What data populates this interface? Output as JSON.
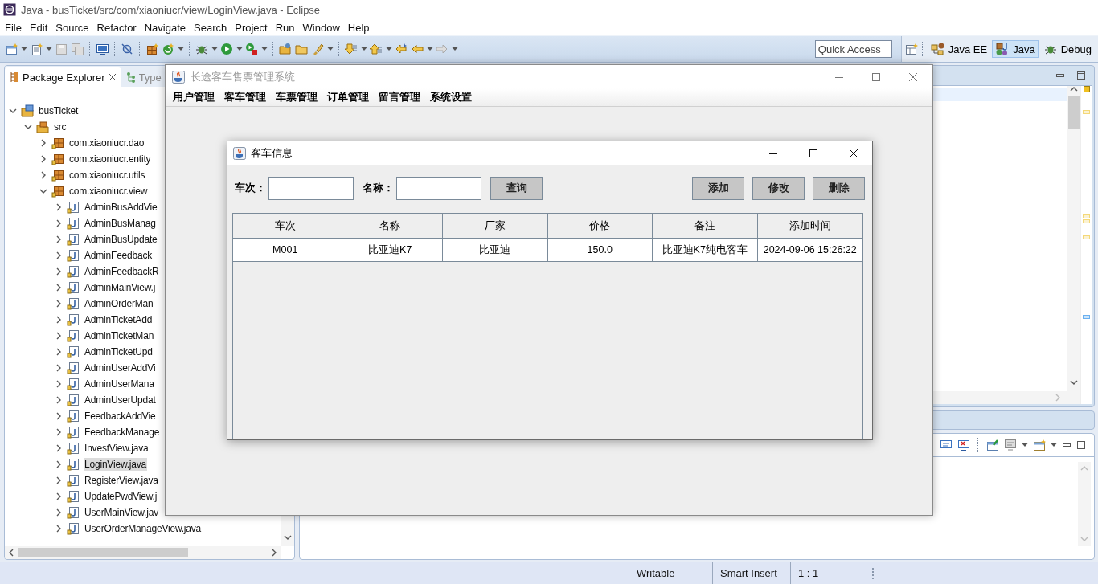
{
  "ide": {
    "title": "Java - busTicket/src/com/xiaoniucr/view/LoginView.java - Eclipse",
    "menu": [
      "File",
      "Edit",
      "Source",
      "Refactor",
      "Navigate",
      "Search",
      "Project",
      "Run",
      "Window",
      "Help"
    ],
    "quick_access": {
      "placeholder": "Quick Access"
    },
    "perspectives": [
      {
        "label": "Java EE",
        "selected": false
      },
      {
        "label": "Java",
        "selected": true
      },
      {
        "label": "Debug",
        "selected": false
      }
    ],
    "view_tabs": [
      {
        "label": "Package Explorer",
        "selected": true
      },
      {
        "label": "Type",
        "selected": false
      }
    ],
    "tree": [
      {
        "label": "busTicket",
        "kind": "project",
        "expanded": true,
        "selected": false,
        "children": [
          {
            "label": "src",
            "kind": "source",
            "expanded": true,
            "selected": false,
            "children": [
              {
                "label": "com.xiaoniucr.dao",
                "kind": "package",
                "expanded": false,
                "selected": false
              },
              {
                "label": "com.xiaoniucr.entity",
                "kind": "package",
                "expanded": false,
                "selected": false
              },
              {
                "label": "com.xiaoniucr.utils",
                "kind": "package",
                "expanded": false,
                "selected": false
              },
              {
                "label": "com.xiaoniucr.view",
                "kind": "package",
                "expanded": true,
                "selected": false,
                "children": [
                  {
                    "label": "AdminBusAddVie",
                    "kind": "file",
                    "expanded": false,
                    "selected": false
                  },
                  {
                    "label": "AdminBusManag",
                    "kind": "file",
                    "expanded": false,
                    "selected": false
                  },
                  {
                    "label": "AdminBusUpdate",
                    "kind": "file",
                    "expanded": false,
                    "selected": false
                  },
                  {
                    "label": "AdminFeedback",
                    "kind": "file",
                    "expanded": false,
                    "selected": false
                  },
                  {
                    "label": "AdminFeedbackR",
                    "kind": "file",
                    "expanded": false,
                    "selected": false
                  },
                  {
                    "label": "AdminMainView.j",
                    "kind": "file",
                    "expanded": false,
                    "selected": false
                  },
                  {
                    "label": "AdminOrderMan",
                    "kind": "file",
                    "expanded": false,
                    "selected": false
                  },
                  {
                    "label": "AdminTicketAdd",
                    "kind": "file",
                    "expanded": false,
                    "selected": false
                  },
                  {
                    "label": "AdminTicketMan",
                    "kind": "file",
                    "expanded": false,
                    "selected": false
                  },
                  {
                    "label": "AdminTicketUpd",
                    "kind": "file",
                    "expanded": false,
                    "selected": false
                  },
                  {
                    "label": "AdminUserAddVi",
                    "kind": "file",
                    "expanded": false,
                    "selected": false
                  },
                  {
                    "label": "AdminUserMana",
                    "kind": "file",
                    "expanded": false,
                    "selected": false
                  },
                  {
                    "label": "AdminUserUpdat",
                    "kind": "file",
                    "expanded": false,
                    "selected": false
                  },
                  {
                    "label": "FeedbackAddVie",
                    "kind": "file",
                    "expanded": false,
                    "selected": false
                  },
                  {
                    "label": "FeedbackManage",
                    "kind": "file",
                    "expanded": false,
                    "selected": false
                  },
                  {
                    "label": "InvestView.java",
                    "kind": "file",
                    "expanded": false,
                    "selected": false
                  },
                  {
                    "label": "LoginView.java",
                    "kind": "file",
                    "expanded": false,
                    "selected": true
                  },
                  {
                    "label": "RegisterView.java",
                    "kind": "file",
                    "expanded": false,
                    "selected": false
                  },
                  {
                    "label": "UpdatePwdView.j",
                    "kind": "file",
                    "expanded": false,
                    "selected": false
                  },
                  {
                    "label": "UserMainView.jav",
                    "kind": "file",
                    "expanded": false,
                    "selected": false
                  },
                  {
                    "label": "UserOrderManageView.java",
                    "kind": "file",
                    "expanded": false,
                    "selected": false
                  }
                ]
              }
            ]
          }
        ]
      }
    ],
    "status_bar": [
      "Writable",
      "Smart Insert",
      "1 : 1"
    ]
  },
  "app_window": {
    "title": "长途客车售票管理系统",
    "active": false,
    "menu": [
      "用户管理",
      "客车管理",
      "车票管理",
      "订单管理",
      "留言管理",
      "系统设置"
    ]
  },
  "dialog": {
    "title": "客车信息",
    "active": true,
    "filters": [
      {
        "label": "车次：",
        "focused": false
      },
      {
        "label": "名称：",
        "focused": true
      }
    ],
    "search_button": "查询",
    "actions": [
      "添加",
      "修改",
      "删除"
    ],
    "table": {
      "columns": [
        "车次",
        "名称",
        "厂家",
        "价格",
        "备注",
        "添加时间"
      ],
      "rows": [
        [
          "M001",
          "比亚迪K7",
          "比亚迪",
          "150.0",
          "比亚迪K7纯电客车",
          "2024-09-06 15:26:22"
        ]
      ]
    }
  }
}
